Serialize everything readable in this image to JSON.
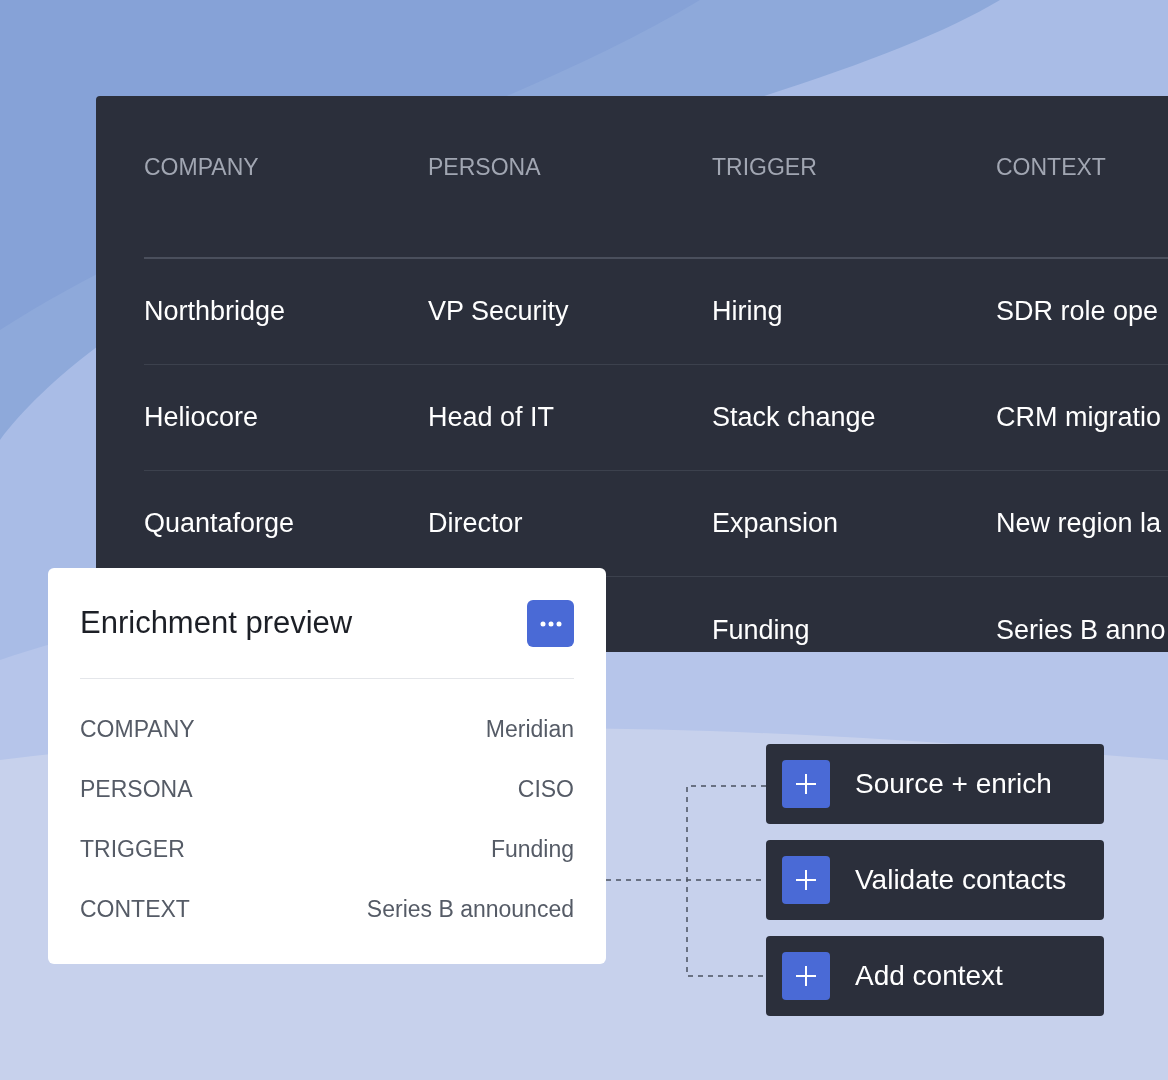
{
  "table": {
    "columns": [
      "COMPANY",
      "PERSONA",
      "TRIGGER",
      "CONTEXT"
    ],
    "rows": [
      {
        "company": "Northbridge",
        "persona": "VP Security",
        "trigger": "Hiring",
        "context": "SDR role ope"
      },
      {
        "company": "Heliocore",
        "persona": "Head of IT",
        "trigger": "Stack change",
        "context": "CRM migratio"
      },
      {
        "company": "Quantaforge",
        "persona": "Director",
        "trigger": "Expansion",
        "context": "New region la"
      },
      {
        "trigger": "Funding",
        "context": "Series B anno"
      }
    ]
  },
  "preview_card": {
    "title": "Enrichment preview",
    "fields": [
      {
        "label": "COMPANY",
        "value": "Meridian"
      },
      {
        "label": "PERSONA",
        "value": "CISO"
      },
      {
        "label": "TRIGGER",
        "value": "Funding"
      },
      {
        "label": "CONTEXT",
        "value": "Series B announced"
      }
    ]
  },
  "actions": [
    {
      "label": "Source + enrich"
    },
    {
      "label": "Validate contacts"
    },
    {
      "label": "Add context"
    }
  ]
}
